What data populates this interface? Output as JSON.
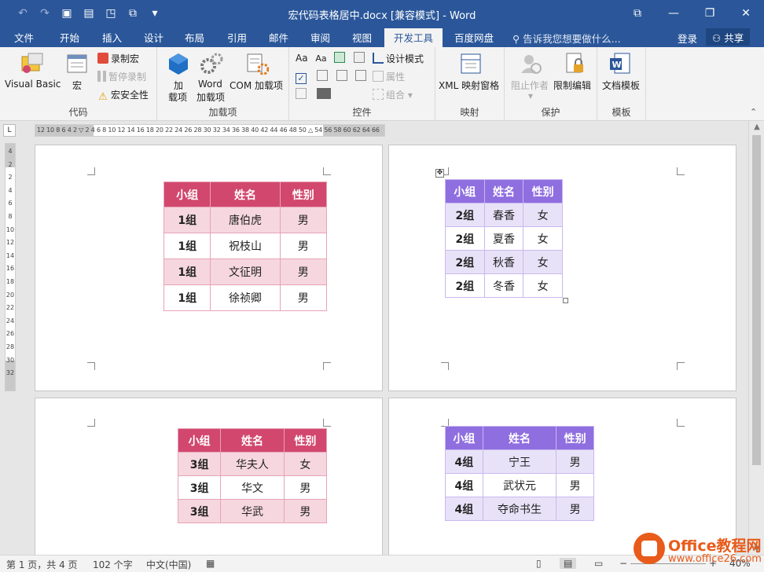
{
  "window": {
    "title": "宏代码表格居中.docx [兼容模式] - Word",
    "minimize": "—",
    "restore": "❐",
    "close": "✕",
    "ribbon_display": "⧉"
  },
  "qat": {
    "undo": "↶",
    "redo": "↷",
    "save": "💾",
    "customize": "▾"
  },
  "tabs": [
    "文件",
    "开始",
    "插入",
    "设计",
    "布局",
    "引用",
    "邮件",
    "审阅",
    "视图",
    "开发工具",
    "百度网盘"
  ],
  "active_tab": "开发工具",
  "tellme": "告诉我您想要做什么...",
  "signin": "登录",
  "share": "共享",
  "ribbon": {
    "code": {
      "label": "代码",
      "visual_basic": "Visual Basic",
      "macros": "宏",
      "record_macro": "录制宏",
      "pause_recording": "暂停录制",
      "macro_security": "宏安全性"
    },
    "addins": {
      "label": "加载项",
      "addins_line1": "加",
      "addins_line2": "载项",
      "word_addins_line1": "Word",
      "word_addins_line2": "加载项",
      "com_addins": "COM 加载项"
    },
    "controls": {
      "label": "控件",
      "design_mode": "设计模式",
      "properties": "属性",
      "group": "组合"
    },
    "mapping": {
      "label": "映射",
      "xml_pane": "XML 映射窗格"
    },
    "protect": {
      "label": "保护",
      "block_authors": "阻止作者",
      "restrict_editing": "限制编辑"
    },
    "templates": {
      "label": "模板",
      "document_template": "文档模板"
    }
  },
  "ruler": {
    "corner": "L",
    "horizontal": "12 10  8  6  4  2  ▽  2  4  6  8 10 12 14 16 18 20 22 24 26 28 30 32 34 36 38 40 42 44 46 48 50  △ 54 56 58 60 62 64 66",
    "vertical": [
      "4",
      "2",
      "",
      "2",
      "4",
      "6",
      "8",
      "10",
      "12",
      "14",
      "16",
      "18",
      "20",
      "22",
      "24",
      "26",
      "28",
      "30",
      "32"
    ]
  },
  "tables": [
    {
      "headers": [
        "小组",
        "姓名",
        "性别"
      ],
      "rows": [
        [
          "1组",
          "唐伯虎",
          "男"
        ],
        [
          "1组",
          "祝枝山",
          "男"
        ],
        [
          "1组",
          "文征明",
          "男"
        ],
        [
          "1组",
          "徐祯卿",
          "男"
        ]
      ]
    },
    {
      "headers": [
        "小组",
        "姓名",
        "性别"
      ],
      "rows": [
        [
          "2组",
          "春香",
          "女"
        ],
        [
          "2组",
          "夏香",
          "女"
        ],
        [
          "2组",
          "秋香",
          "女"
        ],
        [
          "2组",
          "冬香",
          "女"
        ]
      ]
    },
    {
      "headers": [
        "小组",
        "姓名",
        "性别"
      ],
      "rows": [
        [
          "3组",
          "华夫人",
          "女"
        ],
        [
          "3组",
          "华文",
          "男"
        ],
        [
          "3组",
          "华武",
          "男"
        ]
      ]
    },
    {
      "headers": [
        "小组",
        "姓名",
        "性别"
      ],
      "rows": [
        [
          "4组",
          "宁王",
          "男"
        ],
        [
          "4组",
          "武状元",
          "男"
        ],
        [
          "4组",
          "夺命书生",
          "男"
        ]
      ]
    }
  ],
  "colors": {
    "word_blue": "#2b579a",
    "red_header": "#d2476e",
    "purple_header": "#8f6ee0"
  },
  "status": {
    "page": "第 1 页，共 4 页",
    "words": "102 个字",
    "language": "中文(中国)",
    "zoom": "40%"
  },
  "watermark": {
    "title": "Office教程网",
    "url": "www.office26.com"
  }
}
